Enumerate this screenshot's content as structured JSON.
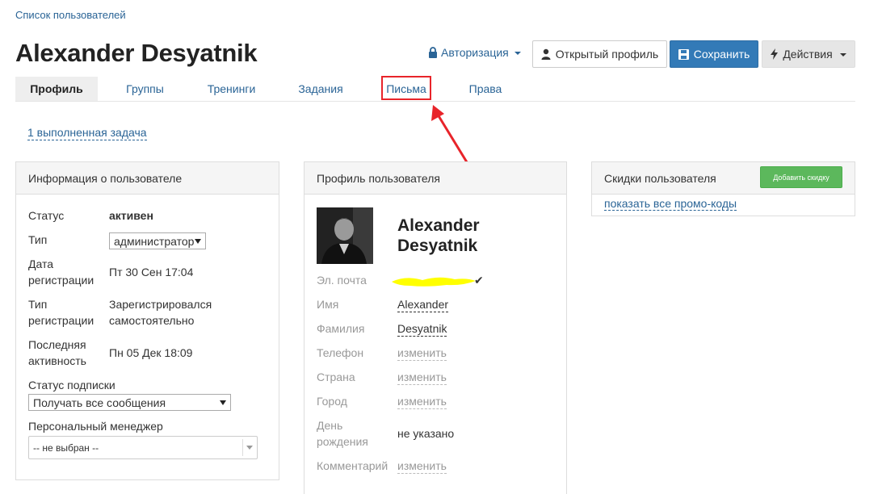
{
  "breadcrumb": "Список пользователей",
  "page_title": "Alexander Desyatnik",
  "header": {
    "auth_label": "Авторизация",
    "open_profile_label": "Открытый профиль",
    "save_label": "Сохранить",
    "actions_label": "Действия"
  },
  "tabs": [
    {
      "label": "Профиль",
      "active": true
    },
    {
      "label": "Группы"
    },
    {
      "label": "Тренинги"
    },
    {
      "label": "Задания"
    },
    {
      "label": "Письма"
    },
    {
      "label": "Права"
    }
  ],
  "tasks_link": "1 выполненная задача",
  "info_panel": {
    "title": "Информация о пользователе",
    "status_label": "Статус",
    "status_value": "активен",
    "type_label": "Тип",
    "type_value": "администратор",
    "reg_date_label_1": "Дата",
    "reg_date_label_2": "регистрации",
    "reg_date_value": "Пт 30 Сен 17:04",
    "reg_type_label_1": "Тип",
    "reg_type_label_2": "регистрации",
    "reg_type_value_1": "Зарегистрировался",
    "reg_type_value_2": "самостоятельно",
    "last_activity_label_1": "Последняя",
    "last_activity_label_2": "активность",
    "last_activity_value": "Пн 05 Дек 18:09",
    "subscription_label": "Статус подписки",
    "subscription_value": "Получать все сообщения",
    "manager_label": "Персональный менеджер",
    "manager_value": "-- не выбран --"
  },
  "profile_panel": {
    "title": "Профиль пользователя",
    "name_line_1": "Alexander",
    "name_line_2": "Desyatnik",
    "email_label": "Эл. почта",
    "first_name_label": "Имя",
    "first_name_value": "Alexander",
    "last_name_label": "Фамилия",
    "last_name_value": "Desyatnik",
    "phone_label": "Телефон",
    "phone_value": "изменить",
    "country_label": "Страна",
    "country_value": "изменить",
    "city_label": "Город",
    "city_value": "изменить",
    "birthday_label_1": "День",
    "birthday_label_2": "рождения",
    "birthday_value": "не указано",
    "comment_label": "Комментарий",
    "comment_value": "изменить"
  },
  "discounts_panel": {
    "title": "Скидки пользователя",
    "add_button": "Добавить скидку",
    "promo_link": "показать все промо-коды"
  },
  "colors": {
    "primary": "#337ab7",
    "success": "#5cb85c",
    "link": "#2a6496",
    "annotation": "#e8242a",
    "email_redaction": "#ffff00"
  }
}
